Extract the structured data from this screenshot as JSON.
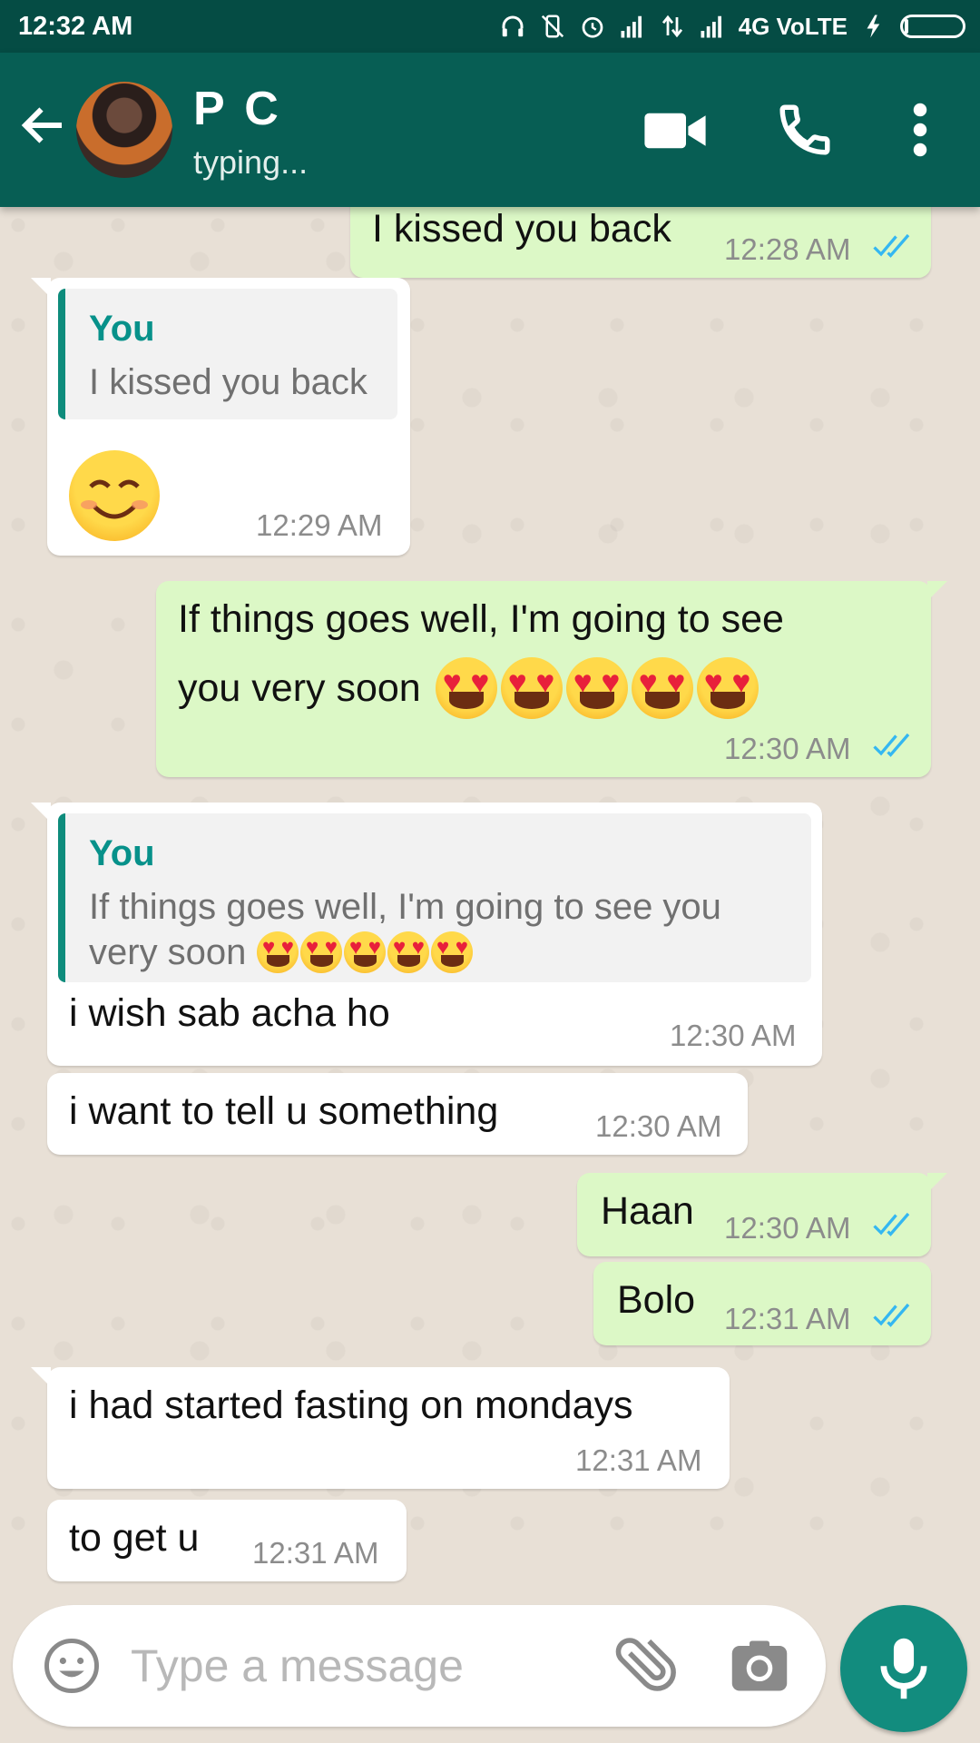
{
  "status_bar": {
    "time": "12:32 AM",
    "network_label": "4G VoLTE"
  },
  "header": {
    "contact_name": "P C",
    "status": "typing..."
  },
  "messages": [
    {
      "id": "m0",
      "direction": "out",
      "text": "I kissed you back",
      "time": "12:28 AM",
      "ticks": "read"
    },
    {
      "id": "m1",
      "direction": "in",
      "quote_author": "You",
      "quote_text": "I kissed you back",
      "text": "☺",
      "time": "12:29 AM"
    },
    {
      "id": "m2",
      "direction": "out",
      "text_line1": "If things goes well, I'm going to see",
      "text_line2": "you very soon",
      "emoji_count": 5,
      "time": "12:30 AM",
      "ticks": "read"
    },
    {
      "id": "m3",
      "direction": "in",
      "quote_author": "You",
      "quote_line1": "If things goes well, I'm going to see you",
      "quote_line2": "very soon",
      "quote_emoji_count": 5,
      "text": "i wish sab acha ho",
      "time": "12:30 AM"
    },
    {
      "id": "m4",
      "direction": "in",
      "text": "i want to tell u something",
      "time": "12:30 AM"
    },
    {
      "id": "m5",
      "direction": "out",
      "text": "Haan",
      "time": "12:30 AM",
      "ticks": "read"
    },
    {
      "id": "m6",
      "direction": "out",
      "text": "Bolo",
      "time": "12:31 AM",
      "ticks": "read"
    },
    {
      "id": "m7",
      "direction": "in",
      "text": "i had started fasting on mondays",
      "time": "12:31 AM"
    },
    {
      "id": "m8",
      "direction": "in",
      "text": "to get u",
      "time": "12:31 AM"
    }
  ],
  "composer": {
    "placeholder": "Type a message"
  },
  "icons": {
    "back": "arrow-left-icon",
    "video": "video-camera-icon",
    "call": "phone-icon",
    "more": "more-vert-icon",
    "emoji": "smiley-icon",
    "attach": "paperclip-icon",
    "camera": "camera-icon",
    "mic": "microphone-icon"
  },
  "colors": {
    "header": "#075e54",
    "status_bar": "#054c44",
    "outgoing_bubble": "#dcf8c6",
    "incoming_bubble": "#ffffff",
    "quote_accent": "#0e8c7c",
    "read_ticks": "#34b7f1",
    "mic_button": "#128c7e"
  }
}
